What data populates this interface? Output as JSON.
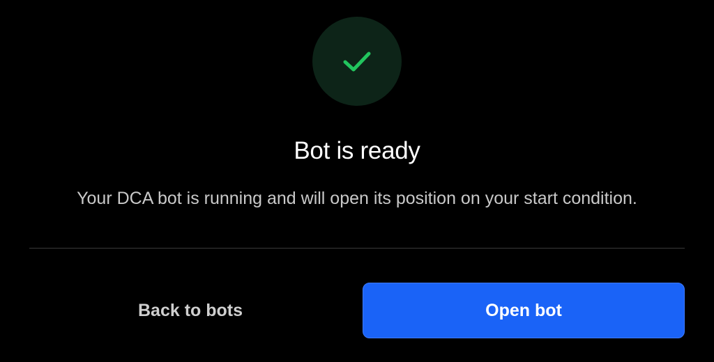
{
  "dialog": {
    "icon": "checkmark-icon",
    "title": "Bot is ready",
    "description": "Your DCA bot is running and will open its position on your start condition.",
    "back_label": "Back to bots",
    "open_label": "Open bot"
  },
  "colors": {
    "background": "#000000",
    "success_circle": "#0d2418",
    "success_check": "#22c55e",
    "primary_button": "#1a63f7",
    "divider": "#3a3a3a"
  }
}
